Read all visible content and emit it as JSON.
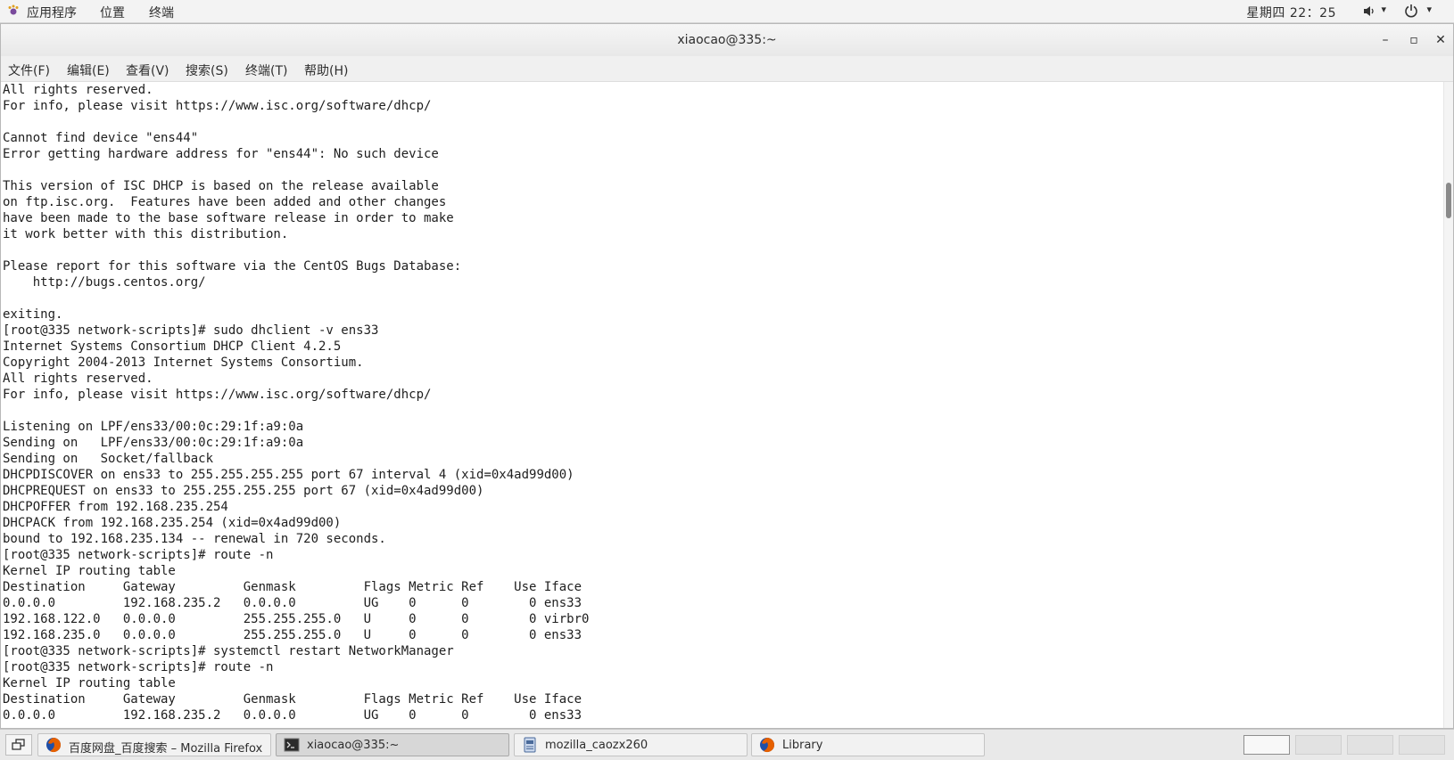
{
  "topbar": {
    "apps_label": "应用程序",
    "places_label": "位置",
    "terminal_label": "终端",
    "clock": "星期四 22：25"
  },
  "window": {
    "title": "xiaocao@335:~",
    "minimize": "–",
    "maximize": "▫",
    "close": "✕"
  },
  "menu": {
    "file": "文件(F)",
    "edit": "编辑(E)",
    "view": "查看(V)",
    "search": "搜索(S)",
    "terminal": "终端(T)",
    "help": "帮助(H)"
  },
  "terminal": {
    "lines": [
      "All rights reserved.",
      "For info, please visit https://www.isc.org/software/dhcp/",
      "",
      "Cannot find device \"ens44\"",
      "Error getting hardware address for \"ens44\": No such device",
      "",
      "This version of ISC DHCP is based on the release available",
      "on ftp.isc.org.  Features have been added and other changes",
      "have been made to the base software release in order to make",
      "it work better with this distribution.",
      "",
      "Please report for this software via the CentOS Bugs Database:",
      "    http://bugs.centos.org/",
      "",
      "exiting.",
      "[root@335 network-scripts]# sudo dhclient -v ens33",
      "Internet Systems Consortium DHCP Client 4.2.5",
      "Copyright 2004-2013 Internet Systems Consortium.",
      "All rights reserved.",
      "For info, please visit https://www.isc.org/software/dhcp/",
      "",
      "Listening on LPF/ens33/00:0c:29:1f:a9:0a",
      "Sending on   LPF/ens33/00:0c:29:1f:a9:0a",
      "Sending on   Socket/fallback",
      "DHCPDISCOVER on ens33 to 255.255.255.255 port 67 interval 4 (xid=0x4ad99d00)",
      "DHCPREQUEST on ens33 to 255.255.255.255 port 67 (xid=0x4ad99d00)",
      "DHCPOFFER from 192.168.235.254",
      "DHCPACK from 192.168.235.254 (xid=0x4ad99d00)",
      "bound to 192.168.235.134 -- renewal in 720 seconds.",
      "[root@335 network-scripts]# route -n",
      "Kernel IP routing table",
      "Destination     Gateway         Genmask         Flags Metric Ref    Use Iface",
      "0.0.0.0         192.168.235.2   0.0.0.0         UG    0      0        0 ens33",
      "192.168.122.0   0.0.0.0         255.255.255.0   U     0      0        0 virbr0",
      "192.168.235.0   0.0.0.0         255.255.255.0   U     0      0        0 ens33",
      "[root@335 network-scripts]# systemctl restart NetworkManager",
      "[root@335 network-scripts]# route -n",
      "Kernel IP routing table",
      "Destination     Gateway         Genmask         Flags Metric Ref    Use Iface",
      "0.0.0.0         192.168.235.2   0.0.0.0         UG    0      0        0 ens33"
    ]
  },
  "taskbar": {
    "tasks": [
      {
        "label": "百度网盘_百度搜索 – Mozilla Firefox",
        "icon": "firefox-icon"
      },
      {
        "label": "xiaocao@335:~",
        "icon": "terminal-icon"
      },
      {
        "label": "mozilla_caozx260",
        "icon": "file-manager-icon"
      },
      {
        "label": "Library",
        "icon": "firefox-icon"
      }
    ]
  },
  "colors": {
    "firefox_orange": "#e66000",
    "firefox_blue": "#1f4fa8",
    "text": "#1e1e1e"
  }
}
